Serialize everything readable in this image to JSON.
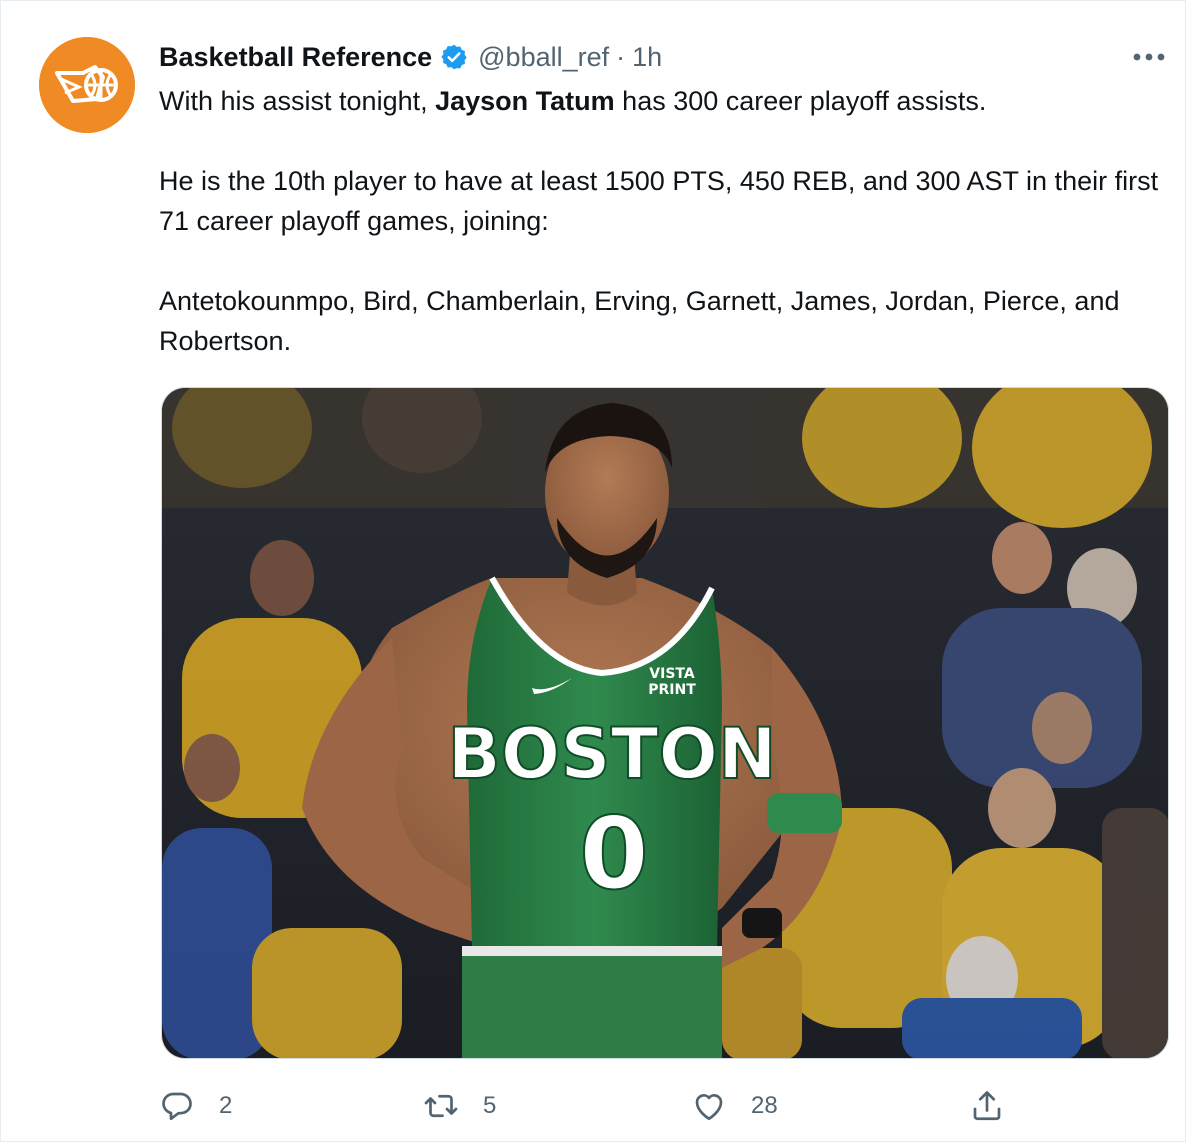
{
  "account": {
    "display_name": "Basketball Reference",
    "handle": "@bball_ref",
    "separator": "·",
    "time": "1h"
  },
  "tweet": {
    "line1_before": "With his assist tonight, ",
    "line1_bold": "Jayson Tatum",
    "line1_after": " has 300 career playoff assists.",
    "paragraph2": "He is the 10th player to have at least 1500 PTS, 450 REB, and 300 AST in their first 71 career playoff games, joining:",
    "paragraph3": "Antetokounmpo, Bird, Chamberlain, Erving, Garnett, James, Jordan, Pierce, and Robertson."
  },
  "media": {
    "jersey_city": "BOSTON",
    "jersey_number": "0",
    "jersey_sponsor_top": "VISTA",
    "jersey_sponsor_bottom": "PRINT"
  },
  "actions": {
    "replies": "2",
    "retweets": "5",
    "likes": "28"
  },
  "colors": {
    "brand_orange": "#f08a24",
    "verified_blue": "#1d9bf0",
    "secondary_text": "#536471",
    "jersey_green": "#2e7d46",
    "crowd_yellow": "#e9b92a"
  },
  "icons": [
    "basketball-reference-logo",
    "verified-badge-icon",
    "more-options-icon",
    "reply-icon",
    "retweet-icon",
    "like-icon",
    "share-icon"
  ]
}
